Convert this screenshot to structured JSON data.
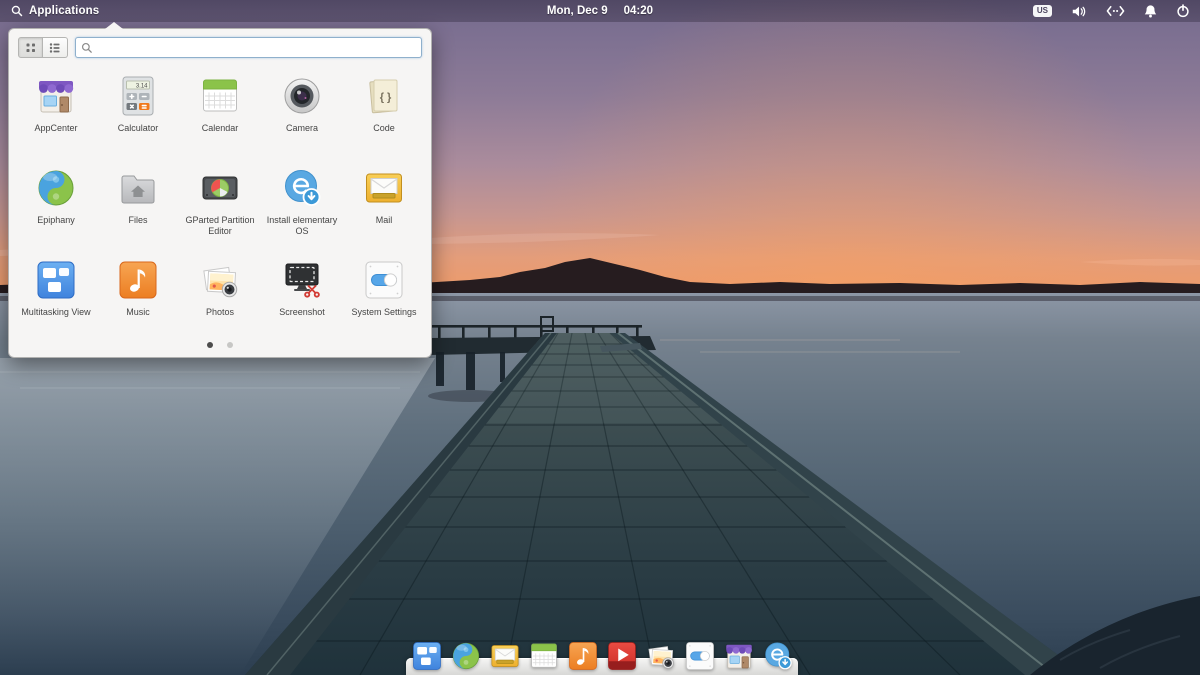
{
  "panel": {
    "app_menu_label": "Applications",
    "date": "Mon, Dec 9",
    "time": "04:20",
    "keyboard_layout": "US",
    "indicator_icons": [
      "keyboard-layout",
      "volume",
      "network",
      "notifications",
      "power"
    ]
  },
  "launcher": {
    "search_placeholder": "",
    "calculator_display": "3.14",
    "code_glyph": "{ }",
    "apps": [
      {
        "label": "AppCenter",
        "icon": "appcenter-icon"
      },
      {
        "label": "Calculator",
        "icon": "calculator-icon"
      },
      {
        "label": "Calendar",
        "icon": "calendar-icon"
      },
      {
        "label": "Camera",
        "icon": "camera-icon"
      },
      {
        "label": "Code",
        "icon": "code-icon"
      },
      {
        "label": "Epiphany",
        "icon": "epiphany-icon"
      },
      {
        "label": "Files",
        "icon": "files-icon"
      },
      {
        "label": "GParted Partition Editor",
        "icon": "gparted-icon"
      },
      {
        "label": "Install elementary OS",
        "icon": "install-elementary-icon"
      },
      {
        "label": "Mail",
        "icon": "mail-icon"
      },
      {
        "label": "Multitasking View",
        "icon": "multitasking-icon"
      },
      {
        "label": "Music",
        "icon": "music-icon"
      },
      {
        "label": "Photos",
        "icon": "photos-icon"
      },
      {
        "label": "Screenshot",
        "icon": "screenshot-icon"
      },
      {
        "label": "System Settings",
        "icon": "system-settings-icon"
      }
    ],
    "pagination": {
      "pages": 2,
      "active_page": 1
    }
  },
  "dock": {
    "items": [
      {
        "name": "Multitasking View",
        "icon": "multitasking-icon"
      },
      {
        "name": "Epiphany",
        "icon": "epiphany-icon"
      },
      {
        "name": "Mail",
        "icon": "mail-icon"
      },
      {
        "name": "Calendar",
        "icon": "calendar-icon"
      },
      {
        "name": "Music",
        "icon": "music-icon"
      },
      {
        "name": "Videos",
        "icon": "videos-icon"
      },
      {
        "name": "Photos",
        "icon": "photos-icon"
      },
      {
        "name": "System Settings",
        "icon": "system-settings-icon"
      },
      {
        "name": "AppCenter",
        "icon": "appcenter-icon"
      },
      {
        "name": "Install elementary OS",
        "icon": "install-elementary-icon"
      }
    ]
  },
  "colors": {
    "sky_top": "#746a8e",
    "sky_horizon": "#f09a68",
    "water_top": "#8d97a6",
    "water_bottom": "#2c3e50",
    "launcher_bg": "#f6f5f4",
    "dock_bg": "#e9e9e9",
    "accent_blue": "#57a6e8"
  }
}
